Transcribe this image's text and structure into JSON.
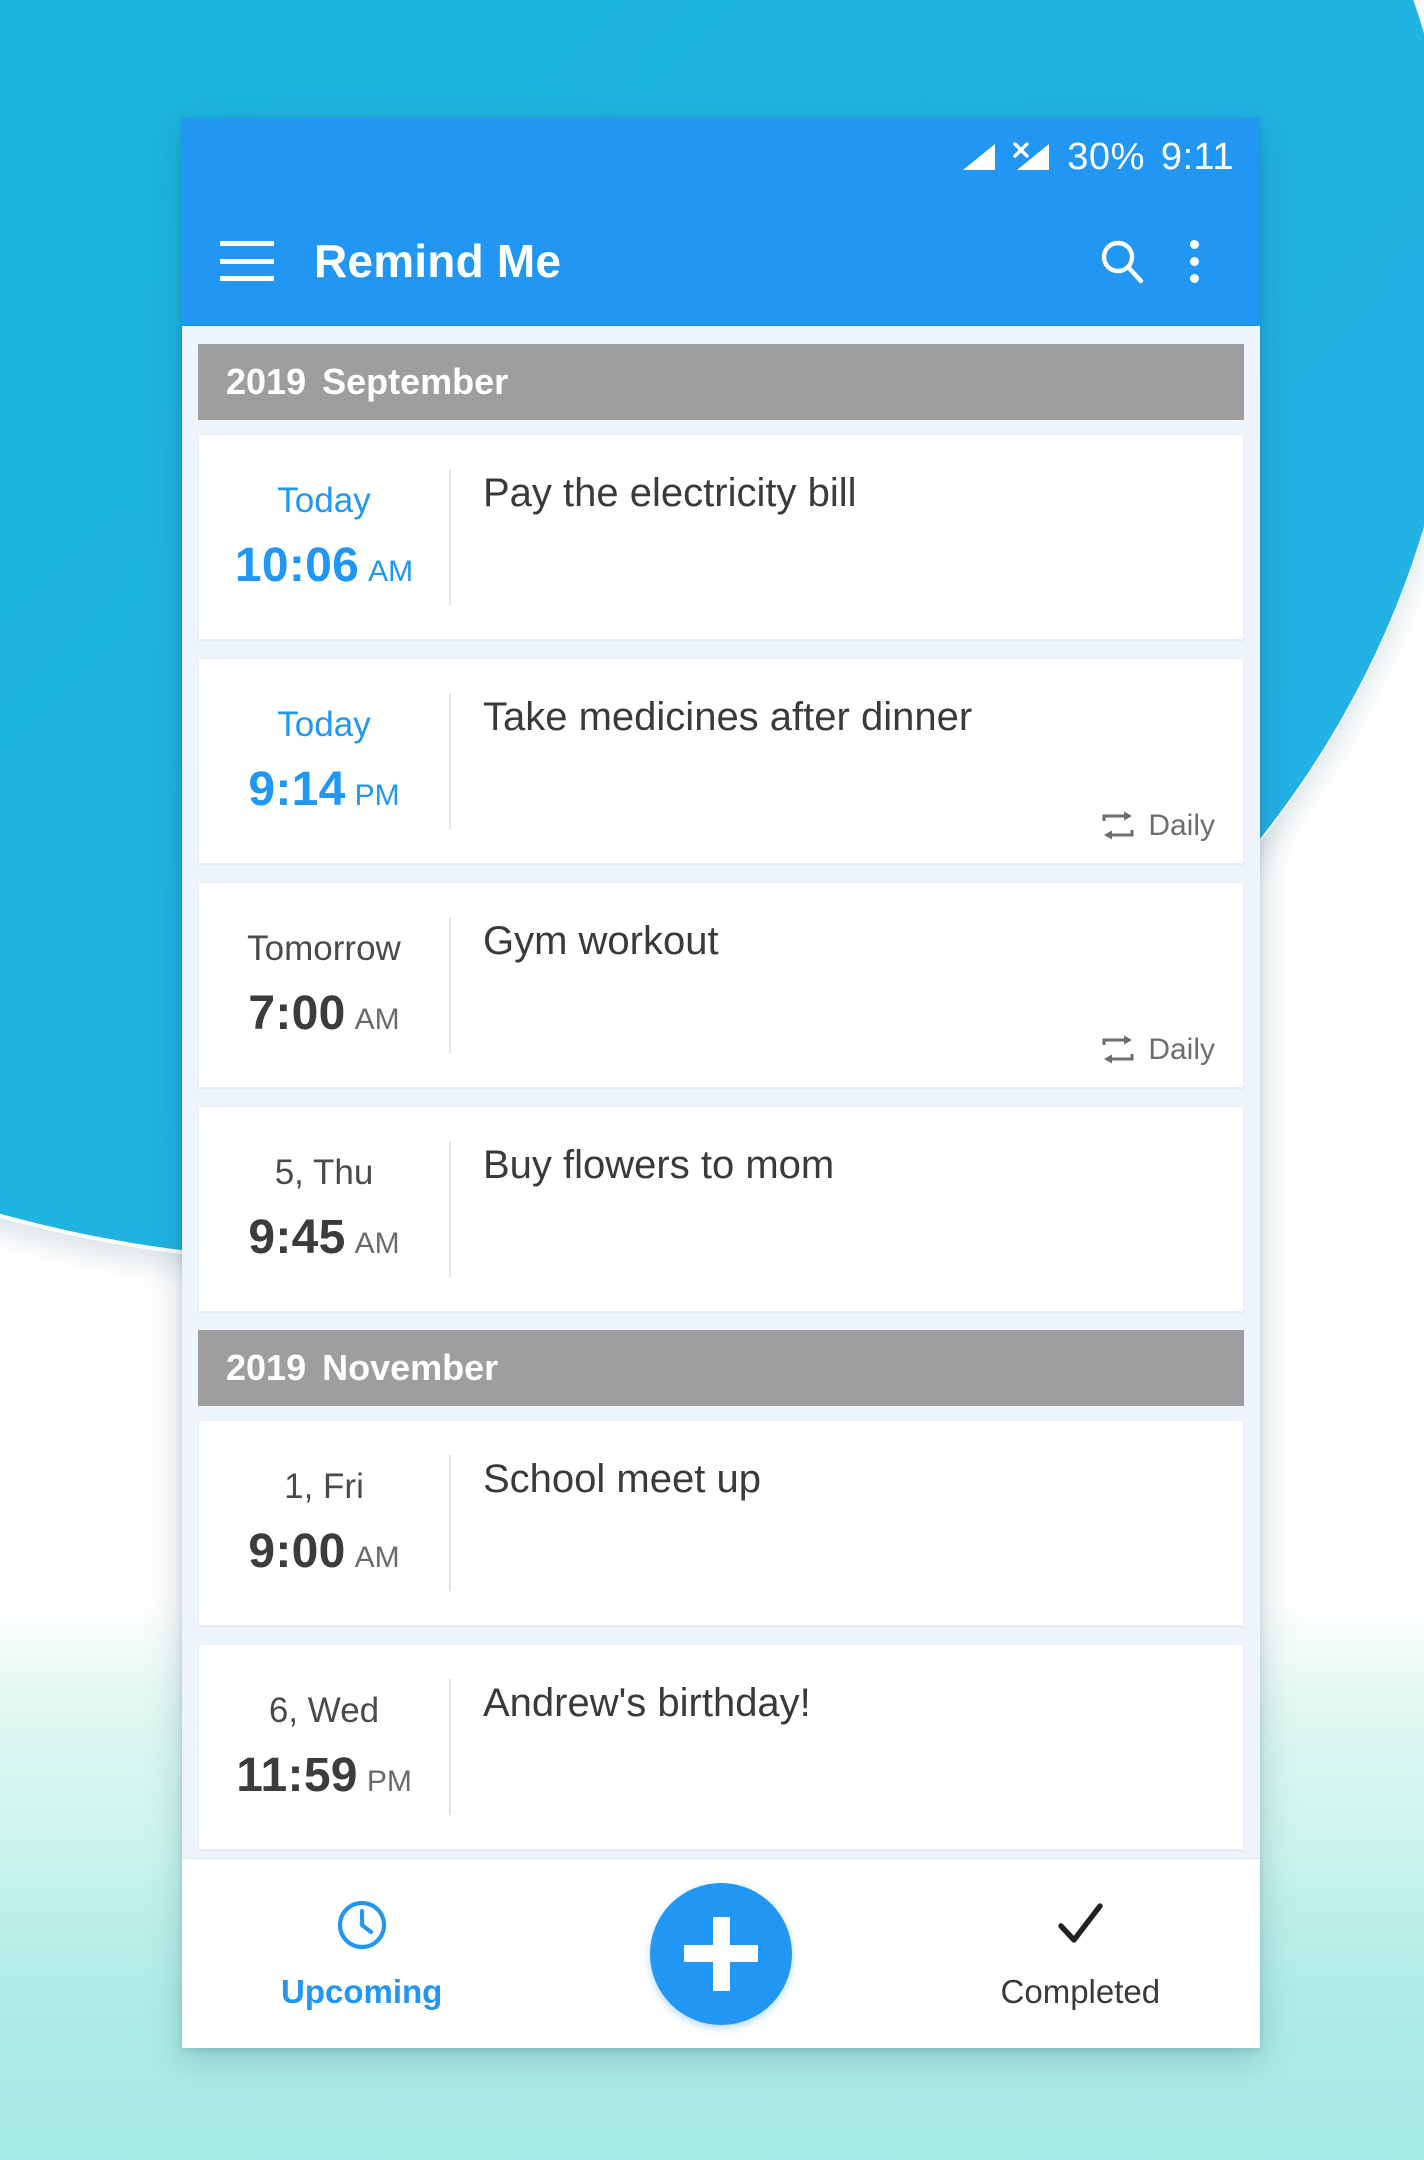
{
  "colors": {
    "accent": "#2196f3",
    "appbar": "#2196f3",
    "background_blob": "#1cb6dd",
    "month_header": "#9e9e9e",
    "content_bg": "#eef4fb",
    "card_bg": "#ffffff",
    "text_primary": "#3a3a3a",
    "text_muted": "#6e6e6e",
    "bottom_wash": "#b7f0e9"
  },
  "status_bar": {
    "signal_icon": "signal-bars-icon",
    "no_sim_icon": "signal-no-service-icon",
    "battery_text": "30%",
    "clock_text": "9:11"
  },
  "app_bar": {
    "menu_icon": "hamburger-menu-icon",
    "title": "Remind Me",
    "search_icon": "search-icon",
    "overflow_icon": "more-vert-icon"
  },
  "sections": [
    {
      "year": "2019",
      "month": "September",
      "reminders": [
        {
          "day": "Today",
          "day_accent": true,
          "time": "10:06",
          "meridiem": "AM",
          "time_accent": true,
          "title": "Pay the electricity bill",
          "repeat_icon": "",
          "repeat_label": ""
        },
        {
          "day": "Today",
          "day_accent": true,
          "time": "9:14",
          "meridiem": "PM",
          "time_accent": true,
          "title": "Take medicines after dinner",
          "repeat_icon": "repeat-icon",
          "repeat_label": "Daily"
        },
        {
          "day": "Tomorrow",
          "day_accent": false,
          "time": "7:00",
          "meridiem": "AM",
          "time_accent": false,
          "title": "Gym workout",
          "repeat_icon": "repeat-icon",
          "repeat_label": "Daily"
        },
        {
          "day": "5, Thu",
          "day_accent": false,
          "time": "9:45",
          "meridiem": "AM",
          "time_accent": false,
          "title": "Buy flowers to mom",
          "repeat_icon": "",
          "repeat_label": ""
        }
      ]
    },
    {
      "year": "2019",
      "month": "November",
      "reminders": [
        {
          "day": "1, Fri",
          "day_accent": false,
          "time": "9:00",
          "meridiem": "AM",
          "time_accent": false,
          "title": "School meet up",
          "repeat_icon": "",
          "repeat_label": ""
        },
        {
          "day": "6, Wed",
          "day_accent": false,
          "time": "11:59",
          "meridiem": "PM",
          "time_accent": false,
          "title": "Andrew's birthday!",
          "repeat_icon": "",
          "repeat_label": ""
        }
      ]
    }
  ],
  "bottom_nav": {
    "upcoming": {
      "icon": "clock-icon",
      "label": "Upcoming",
      "active": true
    },
    "add": {
      "icon": "plus-icon",
      "label": ""
    },
    "completed": {
      "icon": "check-icon",
      "label": "Completed",
      "active": false
    }
  }
}
